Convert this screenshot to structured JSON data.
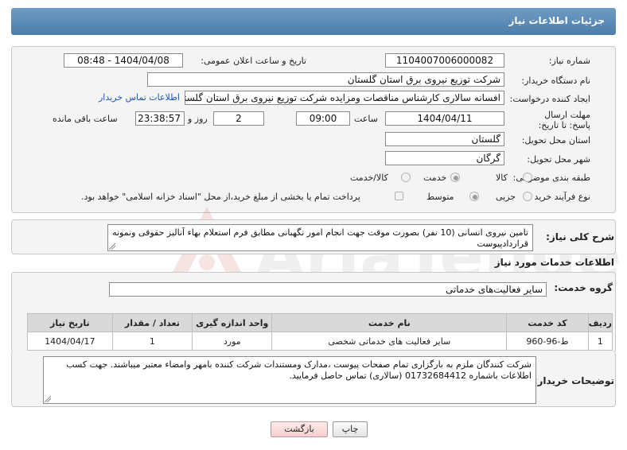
{
  "header": {
    "title": "جزئیات اطلاعات نیاز"
  },
  "form": {
    "need_number": {
      "label": "شماره نیاز:",
      "value": "1104007006000082"
    },
    "announce_datetime": {
      "label": "تاریخ و ساعت اعلان عمومی:",
      "value": "1404/04/08 - 08:48"
    },
    "buyer_org": {
      "label": "نام دستگاه خریدار:",
      "value": "شرکت توزیع نیروی برق استان گلستان"
    },
    "creator": {
      "label": "ایجاد کننده درخواست:",
      "value": "افسانه سالاری کارشناس مناقصات ومزایده شرکت توزیع نیروی برق استان گلستان",
      "contact_link": "اطلاعات تماس خریدار"
    },
    "deadline": {
      "label": "مهلت ارسال پاسخ: تا تاریخ:",
      "date": "1404/04/11",
      "time_label": "ساعت",
      "time": "09:00",
      "days": "2",
      "days_label": "روز و",
      "remaining": "23:38:57",
      "remaining_label": "ساعت باقی مانده"
    },
    "province": {
      "label": "استان محل تحویل:",
      "value": "گلستان"
    },
    "city": {
      "label": "شهر محل تحویل:",
      "value": "گرگان"
    },
    "category": {
      "label": "طبقه بندی موضوعی:",
      "options": [
        "کالا",
        "خدمت",
        "کالا/خدمت"
      ],
      "selected": "خدمت"
    },
    "process_type": {
      "label": "نوع فرآیند خرید :",
      "options": [
        "جزیی",
        "متوسط"
      ],
      "selected": "متوسط",
      "treasury_note": "پرداخت تمام یا بخشی از مبلغ خرید،از محل \"اسناد خزانه اسلامی\" خواهد بود."
    }
  },
  "summary": {
    "label": "شرح کلی نیاز:",
    "text": "تامین نیروی انسانی (10 نفر) بصورت موقت جهت انجام امور نگهبانی مطابق فرم استعلام بهاء آنالیز حقوقی ونمونه قراردادپیوست"
  },
  "services": {
    "section_title": "اطلاعات خدمات مورد نیاز",
    "group_label": "گروه خدمت:",
    "group_value": "سایر فعالیت‌های خدماتی",
    "columns": [
      "ردیف",
      "کد خدمت",
      "نام خدمت",
      "واحد اندازه گیری",
      "تعداد / مقدار",
      "تاریخ نیاز"
    ],
    "rows": [
      [
        "1",
        "ط-96-960",
        "سایر فعالیت های خدماتی شخصی",
        "مورد",
        "1",
        "1404/04/17"
      ]
    ]
  },
  "buyer_notes": {
    "label": "توضیحات خریدار:",
    "text": "شرکت کنندگان ملزم به بارگزاری تمام صفحات پیوست ،مدارک ومستندات شرکت کننده بامهر وامضاء معتبر میباشند. جهت کسب اطلاعات باشماره 01732684412 (سالاری) تماس حاصل فرمایید."
  },
  "buttons": {
    "print": "چاپ",
    "back": "بازگشت"
  },
  "watermark": {
    "text": "AriaTender.net"
  },
  "colors": {
    "header": "#5a89b6",
    "link": "#1a56c4",
    "panel": "#f4f4f4",
    "back_button": "#f6cfcf"
  }
}
